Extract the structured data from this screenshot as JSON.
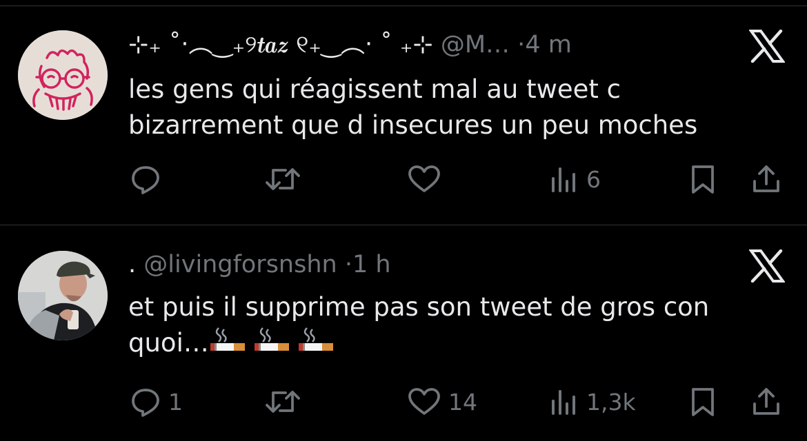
{
  "colors": {
    "background": "#000000",
    "text": "#e7e9ea",
    "muted": "#71767b",
    "divider": "#2f3336"
  },
  "tweets": [
    {
      "display_name": "⊹₊ ˚‧︵‿₊୨𝒕𝒂𝒛 ୧₊‿︵‧ ˚ ₊⊹",
      "handle": "@M…",
      "separator": "·",
      "time": "4 m",
      "text_line1": "les gens qui réagissent mal au tweet c",
      "text_line2": "bizarrement que d insecures un peu moches",
      "text_line2_emoji": "",
      "replies": "",
      "retweets": "",
      "likes": "",
      "views": "6",
      "icons": [
        "reply-icon",
        "retweet-icon",
        "like-icon",
        "views-icon",
        "bookmark-icon",
        "share-icon",
        "x-logo-icon"
      ]
    },
    {
      "display_name": ".",
      "handle": "@livingforsnshn",
      "separator": "·",
      "time": "1 h",
      "text_line1": "et puis il supprime pas son tweet de gros con",
      "text_line2": "quoi…",
      "text_line2_emoji": "🚬🚬🚬",
      "replies": "1",
      "retweets": "",
      "likes": "14",
      "views": "1,3k",
      "icons": [
        "reply-icon",
        "retweet-icon",
        "like-icon",
        "views-icon",
        "bookmark-icon",
        "share-icon",
        "x-logo-icon"
      ]
    }
  ]
}
